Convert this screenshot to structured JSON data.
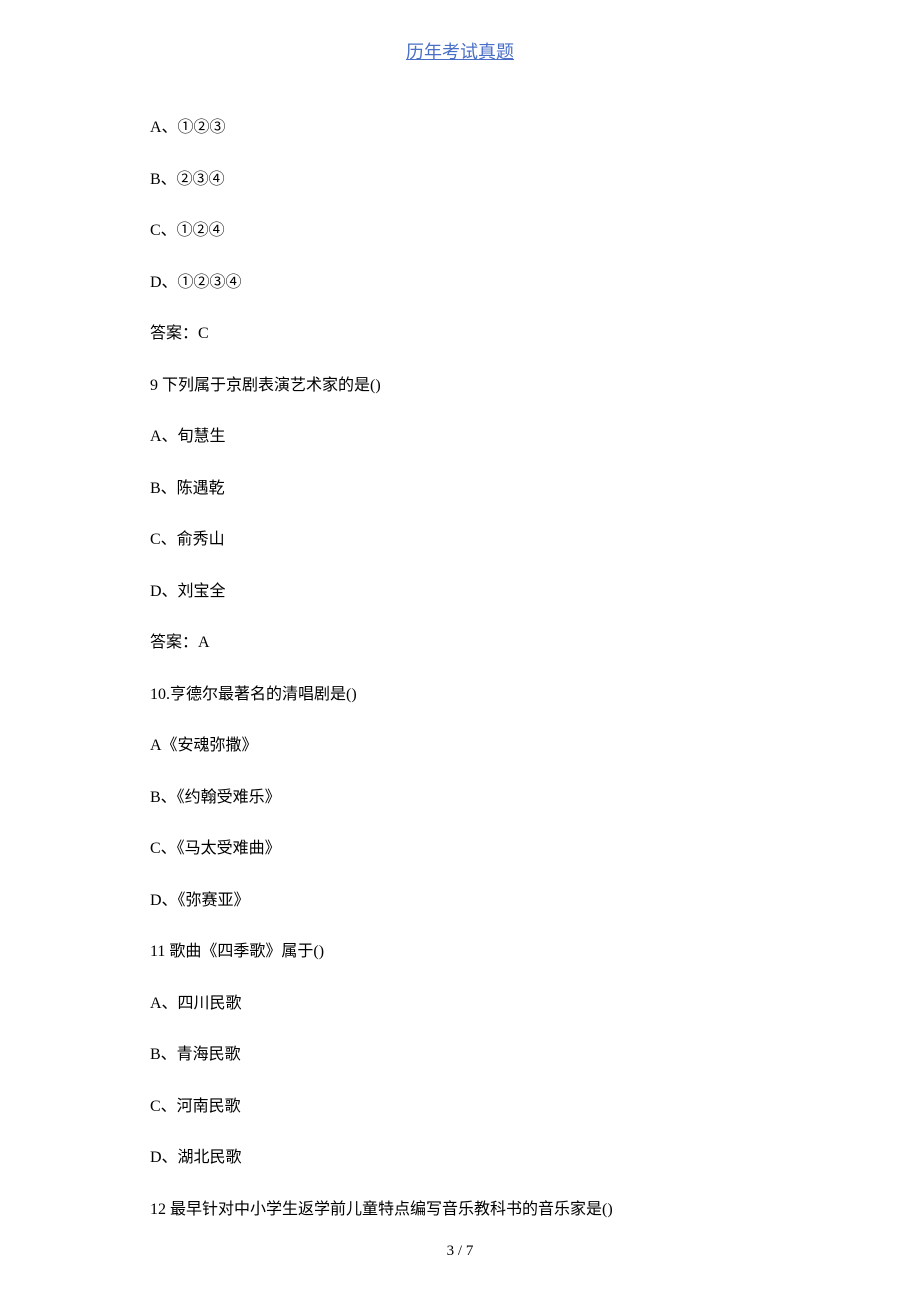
{
  "header": {
    "title": "历年考试真题"
  },
  "content": {
    "lines": [
      "A、①②③",
      "B、②③④",
      "C、①②④",
      "D、①②③④",
      "答案：C",
      "9 下列属于京剧表演艺术家的是()",
      "A、旬慧生",
      "B、陈遇乾",
      "C、俞秀山",
      "D、刘宝全",
      "答案：A",
      "10.亨德尔最著名的清唱剧是()",
      "A《安魂弥撒》",
      "B、《约翰受难乐》",
      "C、《马太受难曲》",
      "D、《弥赛亚》",
      "11 歌曲《四季歌》属于()",
      "A、四川民歌",
      "B、青海民歌",
      "C、河南民歌",
      "D、湖北民歌",
      "12 最早针对中小学生返学前儿童特点编写音乐教科书的音乐家是()"
    ]
  },
  "footer": {
    "page": "3 / 7"
  }
}
